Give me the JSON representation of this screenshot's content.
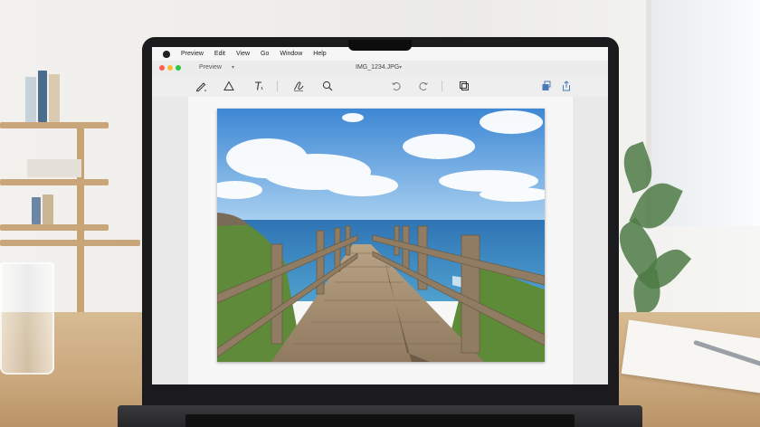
{
  "menubar": {
    "items": [
      "Preview",
      "Edit",
      "View",
      "Go",
      "Window",
      "Help"
    ]
  },
  "window": {
    "app_label": "Preview",
    "document_title": "IMG_1234.JPG"
  },
  "toolbar": {
    "tools": [
      "markup-pen-icon",
      "shapes-triangle-icon",
      "text-icon",
      "signature-icon",
      "magnifier-icon",
      "undo-icon",
      "redo-icon",
      "crop-icon",
      "share-icon",
      "upload-icon"
    ]
  },
  "colors": {
    "close": "#ff5f57",
    "minimize": "#febc2e",
    "zoom": "#28c840"
  }
}
